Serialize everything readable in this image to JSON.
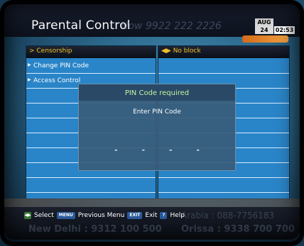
{
  "header": {
    "title": "Parental Control",
    "ghost_text": "Now 9922 222 2226",
    "month": "AUG",
    "day": "24",
    "time": "02:53"
  },
  "left_panel": {
    "header": "> Censorship",
    "items": [
      {
        "label": "Change PIN Code",
        "selected": true
      },
      {
        "label": "Access Control",
        "selected": false
      },
      {
        "label": ""
      },
      {
        "label": ""
      },
      {
        "label": ""
      },
      {
        "label": ""
      },
      {
        "label": ""
      },
      {
        "label": ""
      },
      {
        "label": ""
      }
    ]
  },
  "right_panel": {
    "header": "◀▶ No block"
  },
  "dialog": {
    "title": "PIN Code required",
    "subtitle": "Enter PIN Code",
    "slots": [
      "-",
      "-",
      "-",
      "-"
    ]
  },
  "footer": {
    "select_label": "Select",
    "menu_key": "MENU",
    "previous_menu_label": "Previous Menu",
    "exit_key": "EXIT",
    "exit_label": "Exit",
    "help_key": "?",
    "help_label": "Help",
    "ghost_line1": "Arabia : 088-7756183",
    "ghost_line2_left": "New Delhi : 9312 100 500",
    "ghost_line2_right": "Orissa : 9338 700 700"
  },
  "colors": {
    "panel_bg": "#2a85c8",
    "panel_header_text": "#f4c02a",
    "dialog_title": "#c6f2a4",
    "accent_orange": "#e88a2a"
  },
  "icons": {
    "ok_key": "ok-key-icon",
    "menu_key": "menu-key-icon",
    "exit_key": "exit-key-icon",
    "help_key": "help-key-icon"
  }
}
